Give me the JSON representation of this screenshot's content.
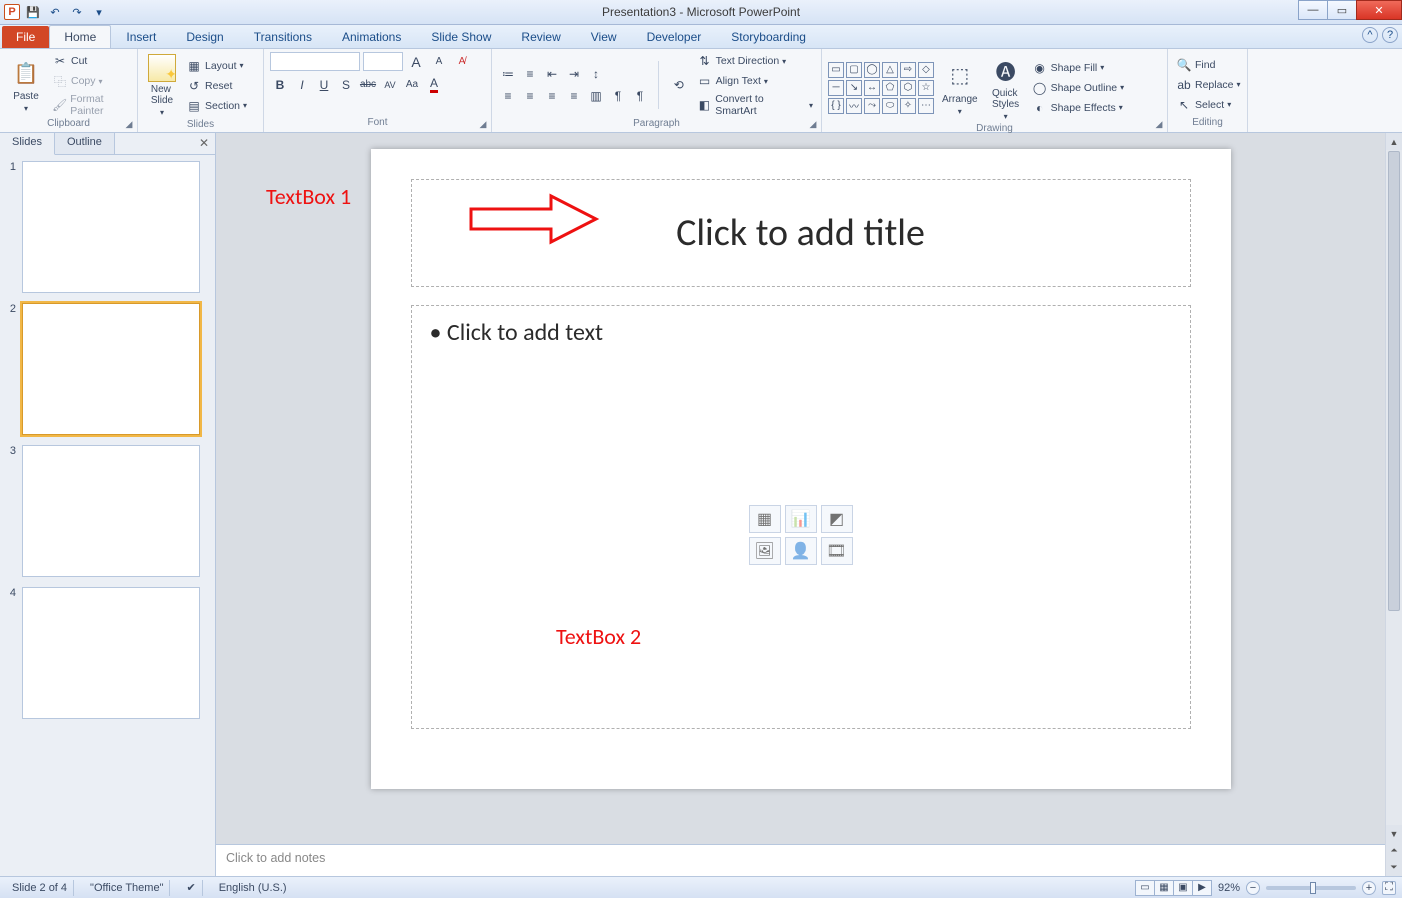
{
  "title": "Presentation3 - Microsoft PowerPoint",
  "qat": {
    "save": "💾",
    "undo": "↶",
    "redo": "↷"
  },
  "tabs": {
    "file": "File",
    "items": [
      "Home",
      "Insert",
      "Design",
      "Transitions",
      "Animations",
      "Slide Show",
      "Review",
      "View",
      "Developer",
      "Storyboarding"
    ],
    "active": "Home"
  },
  "ribbon": {
    "clipboard": {
      "paste": "Paste",
      "cut": "Cut",
      "copy": "Copy",
      "fp": "Format Painter",
      "label": "Clipboard"
    },
    "slides": {
      "new": "New\nSlide",
      "layout": "Layout",
      "reset": "Reset",
      "section": "Section",
      "label": "Slides"
    },
    "font": {
      "bold": "B",
      "italic": "I",
      "underline": "U",
      "shadow": "S",
      "strike": "abc",
      "spacing": "AV",
      "case": "Aa",
      "color": "A",
      "grow": "A",
      "shrink": "A",
      "clear": "✖",
      "label": "Font"
    },
    "paragraph": {
      "bullets": "•",
      "numbers": "≡",
      "indent_dec": "≪",
      "indent_inc": "≫",
      "linesp": "↕",
      "cols": "▥",
      "al": "≡",
      "ac": "≡",
      "ar": "≡",
      "aj": "≡",
      "textdir": "Text Direction",
      "align": "Align Text",
      "smartart": "Convert to SmartArt",
      "label": "Paragraph"
    },
    "drawing": {
      "arrange": "Arrange",
      "quick": "Quick\nStyles",
      "fill": "Shape Fill",
      "outline": "Shape Outline",
      "effects": "Shape Effects",
      "label": "Drawing"
    },
    "editing": {
      "find": "Find",
      "replace": "Replace",
      "select": "Select",
      "label": "Editing"
    }
  },
  "leftpanel": {
    "slides": "Slides",
    "outline": "Outline",
    "thumbs": [
      1,
      2,
      3,
      4
    ],
    "selected": 2
  },
  "slide": {
    "title_placeholder": "Click to add title",
    "body_placeholder": "Click to add text"
  },
  "annotations": {
    "tb1": "TextBox 1",
    "tb2": "TextBox 2"
  },
  "notes": {
    "placeholder": "Click to add notes"
  },
  "status": {
    "pos": "Slide 2 of 4",
    "theme": "\"Office Theme\"",
    "lang": "English (U.S.)",
    "zoom": "92%"
  }
}
